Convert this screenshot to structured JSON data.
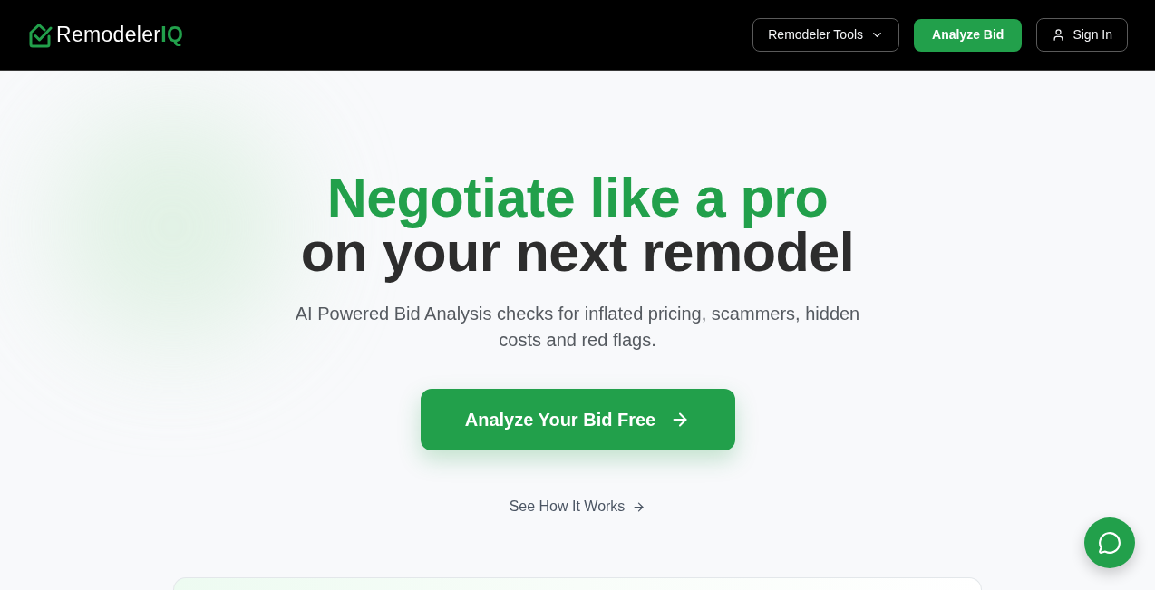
{
  "header": {
    "logo": {
      "text": "Remodeler**IQ**"
    },
    "nav": [
      {
        "kind": "dropdown",
        "label": "Remodeler Tools"
      },
      {
        "kind": "primary",
        "label": "Analyze Bid"
      },
      {
        "kind": "account",
        "label": "Sign In"
      }
    ]
  },
  "hero": {
    "headline": {
      "accent": "Negotiate like a pro",
      "main": "on your next remodel"
    },
    "subtitle": "AI Powered Bid Analysis checks for inflated pricing, scammers, hidden costs and red flags.",
    "cta": "Analyze Your Bid Free",
    "secondary_link": "See How It Works"
  }
}
